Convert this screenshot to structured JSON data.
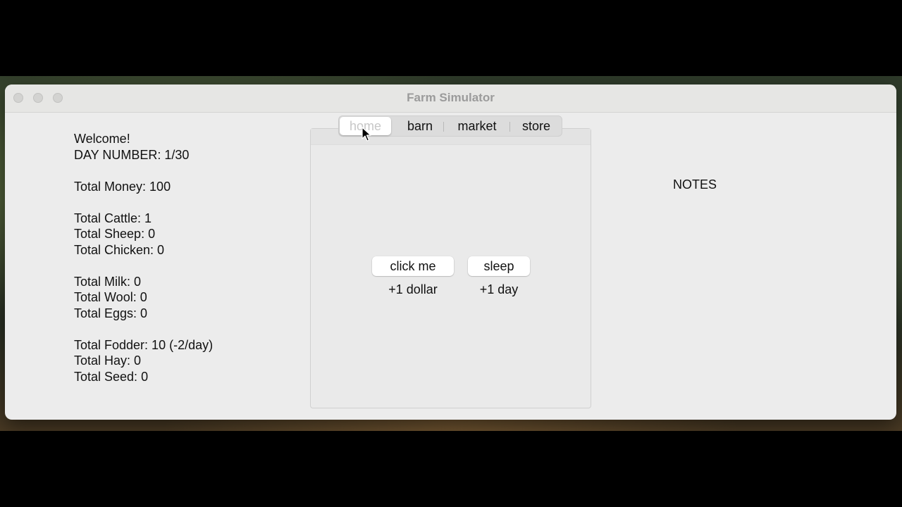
{
  "window": {
    "title": "Farm Simulator"
  },
  "stats": {
    "welcome": "Welcome!",
    "day_number": "DAY NUMBER: 1/30",
    "total_money": "Total Money: 100",
    "total_cattle": "Total Cattle: 1",
    "total_sheep": "Total Sheep: 0",
    "total_chicken": "Total Chicken: 0",
    "total_milk": "Total Milk: 0",
    "total_wool": "Total Wool: 0",
    "total_eggs": "Total Eggs: 0",
    "total_fodder": "Total Fodder: 10 (-2/day)",
    "total_hay": "Total Hay: 0",
    "total_seed": "Total Seed: 0"
  },
  "tabs": [
    {
      "label": "home",
      "selected": true
    },
    {
      "label": "barn",
      "selected": false
    },
    {
      "label": "market",
      "selected": false
    },
    {
      "label": "store",
      "selected": false
    }
  ],
  "home": {
    "click_button_label": "click me",
    "click_caption": "+1 dollar",
    "sleep_button_label": "sleep",
    "sleep_caption": "+1 day"
  },
  "notes": {
    "title": "NOTES"
  },
  "icons": {
    "cursor": "arrow-cursor-icon",
    "close": "close-dot-icon",
    "minimize": "minimize-dot-icon",
    "zoom": "zoom-dot-icon"
  }
}
